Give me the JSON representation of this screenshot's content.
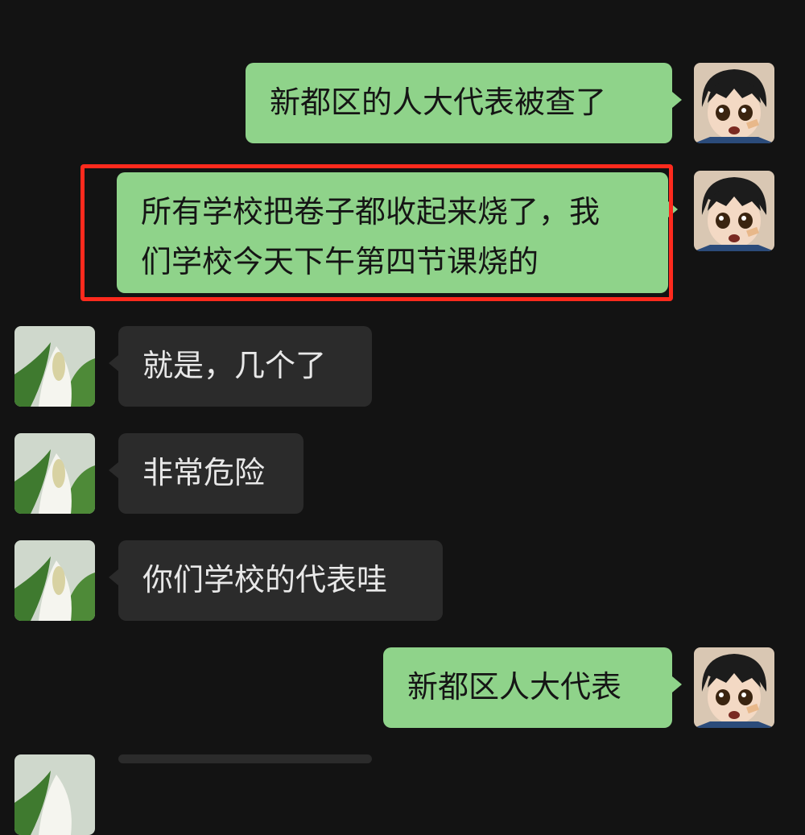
{
  "messages": [
    {
      "side": "out",
      "text": "新都区的人大代表被查了"
    },
    {
      "side": "out",
      "lines": [
        "所有学校把卷子都收起来烧了，我",
        "们学校今天下午第四节课烧的"
      ]
    },
    {
      "side": "in",
      "text": "就是，几个了"
    },
    {
      "side": "in",
      "text": "非常危险"
    },
    {
      "side": "in",
      "text": "你们学校的代表哇"
    },
    {
      "side": "out",
      "text": "新都区人大代表"
    }
  ],
  "colors": {
    "background": "#131313",
    "outgoing_bubble": "#8fd38a",
    "incoming_bubble": "#2b2b2b",
    "highlight_border": "#ff2a1d"
  },
  "avatars": {
    "self": "anime-boy-avatar",
    "contact": "white-flower-avatar"
  }
}
